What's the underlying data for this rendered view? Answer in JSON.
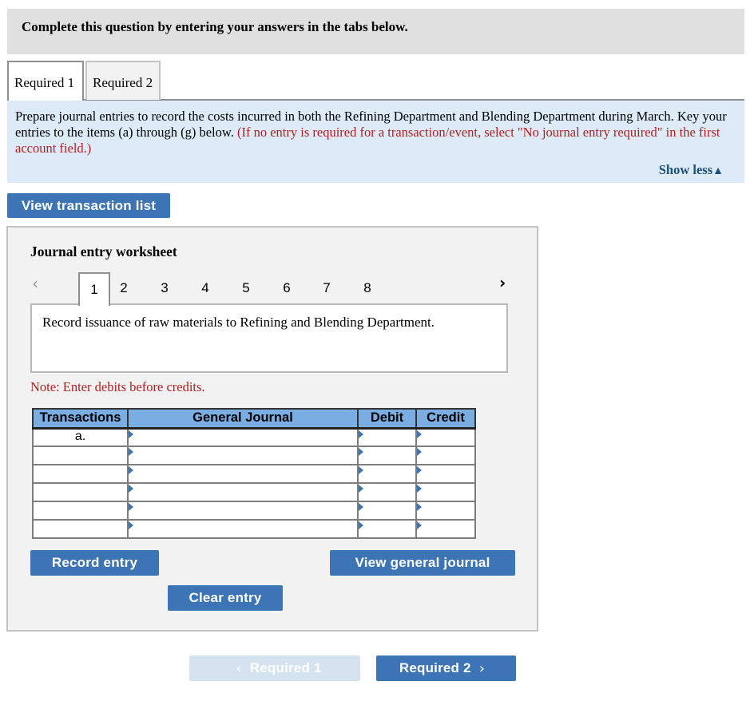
{
  "header": {
    "instruction": "Complete this question by entering your answers in the tabs below."
  },
  "required_tabs": [
    {
      "label": "Required 1",
      "active": true
    },
    {
      "label": "Required 2",
      "active": false
    }
  ],
  "instructions": {
    "text": "Prepare journal entries to record the costs incurred in both the Refining Department and Blending Department during March. Key your entries to the items (a) through (g) below.",
    "note_red": "(If no entry is required for a transaction/event, select \"No journal entry required\" in the first account field.)",
    "show_less": "Show less",
    "show_less_icon": "▲"
  },
  "buttons": {
    "view_transaction_list": "View transaction list",
    "record_entry": "Record entry",
    "view_general_journal": "View general journal",
    "clear_entry": "Clear entry"
  },
  "worksheet": {
    "title": "Journal entry worksheet",
    "pager": {
      "prev_icon": "‹",
      "next_icon": "›",
      "pages": [
        "1",
        "2",
        "3",
        "4",
        "5",
        "6",
        "7",
        "8"
      ],
      "current": "1"
    },
    "description": "Record issuance of raw materials to Refining and Blending Department.",
    "note": "Note: Enter debits before credits.",
    "table": {
      "headers": [
        "Transactions",
        "General Journal",
        "Debit",
        "Credit"
      ],
      "rows": [
        {
          "transaction": "a.",
          "account": "",
          "debit": "",
          "credit": ""
        },
        {
          "transaction": "",
          "account": "",
          "debit": "",
          "credit": ""
        },
        {
          "transaction": "",
          "account": "",
          "debit": "",
          "credit": ""
        },
        {
          "transaction": "",
          "account": "",
          "debit": "",
          "credit": ""
        },
        {
          "transaction": "",
          "account": "",
          "debit": "",
          "credit": ""
        },
        {
          "transaction": "",
          "account": "",
          "debit": "",
          "credit": ""
        }
      ]
    }
  },
  "bottom_nav": {
    "prev_label": "Required 1",
    "prev_icon": "‹",
    "prev_enabled": false,
    "next_label": "Required 2",
    "next_icon": "›",
    "next_enabled": true
  },
  "colors": {
    "button_blue": "#3d74b5",
    "header_blue": "#7aaee3",
    "instruction_bg": "#dcebf7",
    "alert_red": "#b21f1f",
    "link_blue": "#1f4e79"
  }
}
